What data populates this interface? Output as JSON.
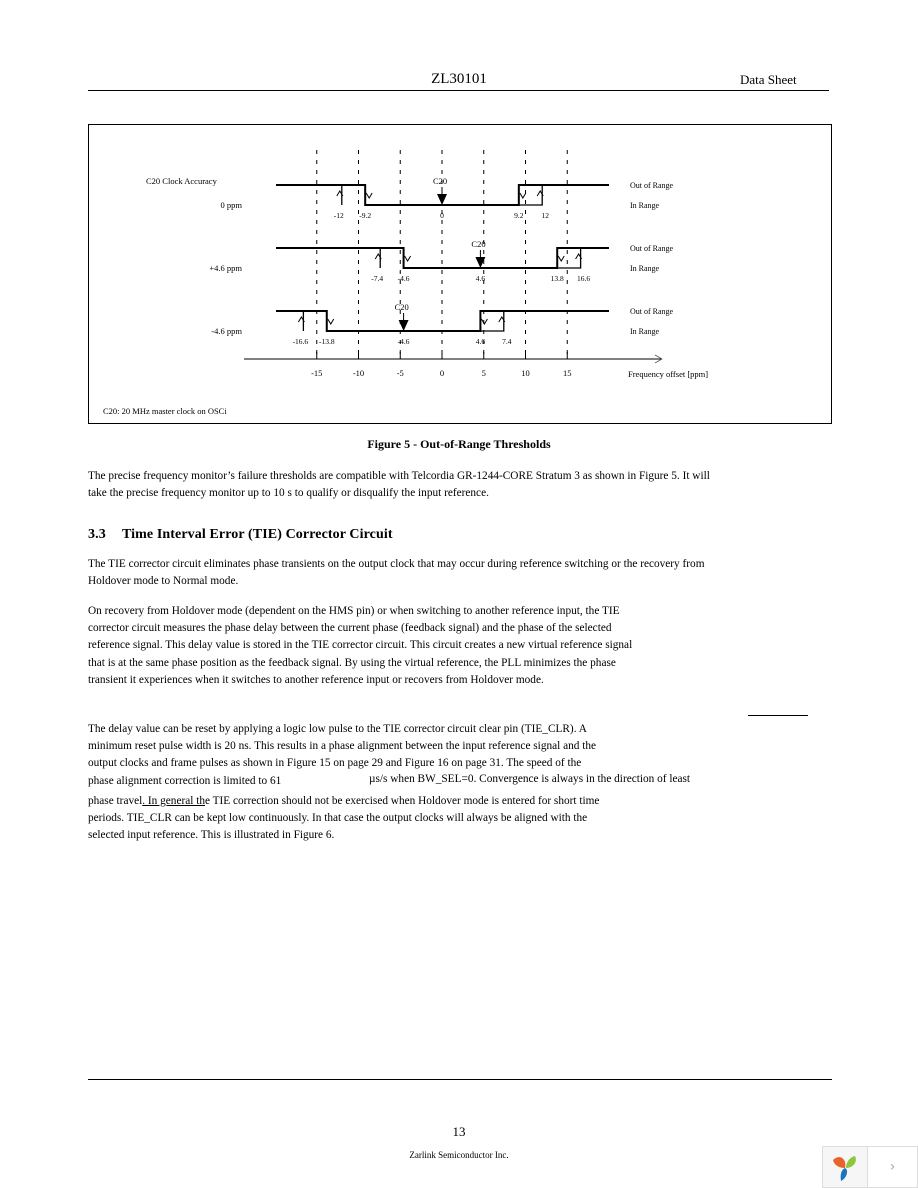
{
  "header": {
    "title": "ZL30101",
    "right": "Data Sheet"
  },
  "figure": {
    "caption": "Figure 5 - Out-of-Range Thresholds",
    "footnote": "C20: 20 MHz master clock on OSCi",
    "heading_label": "C20 Clock Accuracy",
    "out_of_range_label": "Out of Range",
    "in_range_label": "In Range",
    "marker_label": "C20",
    "axis_label": "Frequency offset [ppm]",
    "chart_data": {
      "type": "timing-threshold-diagram",
      "title": "Figure 5 - Out-of-Range Thresholds",
      "xlabel": "Frequency offset [ppm]",
      "xlim": [
        -20,
        20
      ],
      "x_ticks": [
        -15,
        -10,
        -5,
        0,
        5,
        10,
        15
      ],
      "x_tick_labels": [
        "-15",
        "-10",
        "-5",
        "0",
        "5",
        "10",
        "15"
      ],
      "rows": [
        {
          "accuracy_label": "0 ppm",
          "center": 0,
          "low_thresholds": [
            -12,
            -9.2
          ],
          "high_thresholds": [
            9.2,
            12
          ],
          "point_labels": [
            "-12",
            "-9.2",
            "0",
            "9.2",
            "12"
          ]
        },
        {
          "accuracy_label": "+4.6 ppm",
          "center": 4.6,
          "low_thresholds": [
            -7.4,
            -4.6
          ],
          "high_thresholds": [
            13.8,
            16.6
          ],
          "point_labels": [
            "-7.4",
            "-4.6",
            "4.6",
            "13.8",
            "16.6"
          ]
        },
        {
          "accuracy_label": "-4.6 ppm",
          "center": -4.6,
          "low_thresholds": [
            -16.6,
            -13.8
          ],
          "high_thresholds": [
            4.6,
            7.4
          ],
          "point_labels": [
            "-16.6",
            "-13.8",
            "-4.6",
            "4.6",
            "7.4"
          ]
        }
      ]
    }
  },
  "body": {
    "para1": "The precise frequency monitor’s failure thresholds are compatible with Telcordia GR-1244-CORE Stratum 3 as shown in Figure 5. It will take the precise frequency monitor up to 10 s to qualify or disqualify the input reference.",
    "section_number": "3.3",
    "section_title": "Time Interval Error (TIE) Corrector Circuit",
    "para2": "The TIE corrector circuit eliminates phase transients on the output clock that may occur during reference switching or the recovery from Holdover mode to Normal mode.",
    "para3": "On recovery from Holdover mode (dependent on the HMS pin) or when switching to another reference input, the TIE corrector circuit measures the phase delay between the current phase (feedback signal) and the phase of the selected reference signal. This delay value is stored in the TIE corrector circuit. This circuit creates a new virtual reference signal that is at the same phase position as the feedback signal. By using the virtual reference, the PLL minimizes the phase transient it experiences when it switches to another reference input or recovers from Holdover mode.",
    "para4_lines": [
      "The delay value can be reset by applying a logic low pulse to the TIE corrector circuit clear pin (TIE_CLR). A",
      "minimum reset pulse width is 20 ns. This results in a phase alignment between the input reference signal and the",
      "output clocks and frame pulses as shown in Figure 15 on page 29 and Figure 16 on page 31. The speed of the"
    ],
    "para4_line4_a": "phase alignment correction is limited to 61",
    "para4_line4_b": "µs/s when BW_SEL=0. Convergence is always in the direction of least",
    "para4_line5_a": "phase travel",
    "para4_line5_u": ". In general th",
    "para4_line5_b": "e TIE correction should not be exercised when Holdover mode is entered for short time",
    "para4_line6": "periods. TIE_CLR can be kept low continuously. In that case the output clocks will always be aligned with the",
    "para4_line7": "selected input reference. This is illustrated in Figure 6."
  },
  "footer": {
    "page_number": "13",
    "company": "Zarlink Semiconductor Inc.",
    "widget_next_glyph": "›"
  }
}
